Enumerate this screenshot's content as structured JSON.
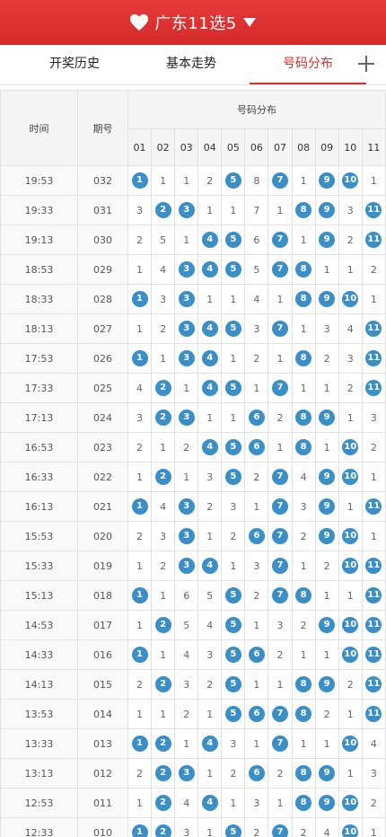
{
  "header": {
    "title": "广东11选5",
    "colors": {
      "bar": "#d42a2a",
      "ball": "#3a8fc8"
    }
  },
  "tabs": [
    {
      "label": "开奖历史",
      "active": false
    },
    {
      "label": "基本走势",
      "active": false
    },
    {
      "label": "号码分布",
      "active": true
    }
  ],
  "table": {
    "col_time": "时间",
    "col_issue": "期号",
    "col_group": "号码分布",
    "numbers": [
      "01",
      "02",
      "03",
      "04",
      "05",
      "06",
      "07",
      "08",
      "09",
      "10",
      "11"
    ],
    "rows": [
      {
        "time": "19:53",
        "issue": "032",
        "cells": [
          "B1",
          "1",
          "1",
          "2",
          "B5",
          "8",
          "B7",
          "1",
          "B9",
          "B10",
          "1"
        ]
      },
      {
        "time": "19:33",
        "issue": "031",
        "cells": [
          "3",
          "B2",
          "B3",
          "1",
          "1",
          "7",
          "1",
          "B8",
          "B9",
          "3",
          "B11"
        ]
      },
      {
        "time": "19:13",
        "issue": "030",
        "cells": [
          "2",
          "5",
          "1",
          "B4",
          "B5",
          "6",
          "B7",
          "1",
          "B9",
          "2",
          "B11"
        ]
      },
      {
        "time": "18:53",
        "issue": "029",
        "cells": [
          "1",
          "4",
          "B3",
          "B4",
          "B5",
          "5",
          "B7",
          "B8",
          "1",
          "1",
          "2"
        ]
      },
      {
        "time": "18:33",
        "issue": "028",
        "cells": [
          "B1",
          "3",
          "B3",
          "1",
          "1",
          "4",
          "1",
          "B8",
          "B9",
          "B10",
          "1"
        ]
      },
      {
        "time": "18:13",
        "issue": "027",
        "cells": [
          "1",
          "2",
          "B3",
          "B4",
          "B5",
          "3",
          "B7",
          "1",
          "3",
          "4",
          "B11"
        ]
      },
      {
        "time": "17:53",
        "issue": "026",
        "cells": [
          "B1",
          "1",
          "B3",
          "B4",
          "1",
          "2",
          "1",
          "B8",
          "2",
          "3",
          "B11"
        ]
      },
      {
        "time": "17:33",
        "issue": "025",
        "cells": [
          "4",
          "B2",
          "1",
          "B4",
          "B5",
          "1",
          "B7",
          "1",
          "1",
          "2",
          "B11"
        ]
      },
      {
        "time": "17:13",
        "issue": "024",
        "cells": [
          "3",
          "B2",
          "B3",
          "1",
          "1",
          "B6",
          "2",
          "B8",
          "B9",
          "1",
          "3"
        ]
      },
      {
        "time": "16:53",
        "issue": "023",
        "cells": [
          "2",
          "1",
          "2",
          "B4",
          "B5",
          "B6",
          "1",
          "B8",
          "1",
          "B10",
          "2"
        ]
      },
      {
        "time": "16:33",
        "issue": "022",
        "cells": [
          "1",
          "B2",
          "1",
          "3",
          "B5",
          "2",
          "B7",
          "4",
          "B9",
          "B10",
          "1"
        ]
      },
      {
        "time": "16:13",
        "issue": "021",
        "cells": [
          "B1",
          "4",
          "B3",
          "2",
          "3",
          "1",
          "B7",
          "3",
          "B9",
          "1",
          "B11"
        ]
      },
      {
        "time": "15:53",
        "issue": "020",
        "cells": [
          "2",
          "3",
          "B3",
          "1",
          "2",
          "B6",
          "B7",
          "2",
          "B9",
          "B10",
          "1"
        ]
      },
      {
        "time": "15:33",
        "issue": "019",
        "cells": [
          "1",
          "2",
          "B3",
          "B4",
          "1",
          "3",
          "B7",
          "1",
          "2",
          "B10",
          "B11"
        ]
      },
      {
        "time": "15:13",
        "issue": "018",
        "cells": [
          "B1",
          "1",
          "6",
          "5",
          "B5",
          "2",
          "B7",
          "B8",
          "1",
          "1",
          "B11"
        ]
      },
      {
        "time": "14:53",
        "issue": "017",
        "cells": [
          "1",
          "B2",
          "5",
          "4",
          "B5",
          "1",
          "3",
          "2",
          "B9",
          "B10",
          "B11"
        ]
      },
      {
        "time": "14:33",
        "issue": "016",
        "cells": [
          "B1",
          "1",
          "4",
          "3",
          "B5",
          "B6",
          "2",
          "1",
          "1",
          "B10",
          "B11"
        ]
      },
      {
        "time": "14:13",
        "issue": "015",
        "cells": [
          "2",
          "B2",
          "3",
          "2",
          "B5",
          "1",
          "1",
          "B8",
          "B9",
          "2",
          "B11"
        ]
      },
      {
        "time": "13:53",
        "issue": "014",
        "cells": [
          "1",
          "1",
          "2",
          "1",
          "B5",
          "B6",
          "B7",
          "B8",
          "2",
          "1",
          "B11"
        ]
      },
      {
        "time": "13:33",
        "issue": "013",
        "cells": [
          "B1",
          "B2",
          "1",
          "B4",
          "3",
          "1",
          "B7",
          "1",
          "1",
          "B10",
          "4"
        ]
      },
      {
        "time": "13:13",
        "issue": "012",
        "cells": [
          "2",
          "B2",
          "B3",
          "1",
          "2",
          "B6",
          "2",
          "B8",
          "B9",
          "1",
          "3"
        ]
      },
      {
        "time": "12:53",
        "issue": "011",
        "cells": [
          "1",
          "B2",
          "4",
          "B4",
          "1",
          "3",
          "1",
          "B8",
          "B9",
          "B10",
          "2"
        ]
      },
      {
        "time": "12:33",
        "issue": "010",
        "cells": [
          "B1",
          "B2",
          "3",
          "1",
          "B5",
          "2",
          "B7",
          "2",
          "4",
          "B10",
          "1"
        ]
      }
    ]
  }
}
